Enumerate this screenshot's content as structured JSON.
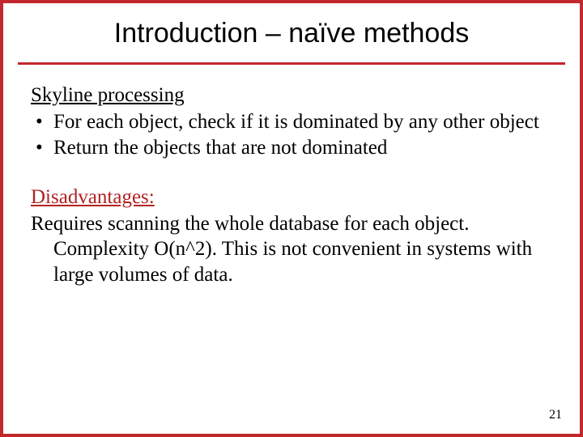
{
  "slide": {
    "title": "Introduction – naïve methods",
    "section1": {
      "heading": "Skyline processing",
      "bullets": [
        "For each object, check if it is dominated by any other object",
        "Return the objects that are not dominated"
      ]
    },
    "section2": {
      "heading": "Disadvantages:",
      "line1": "Requires scanning the whole database for each object.",
      "line2": "Complexity O(n^2). This is not convenient in systems with large volumes of data."
    },
    "page_number": "21"
  }
}
